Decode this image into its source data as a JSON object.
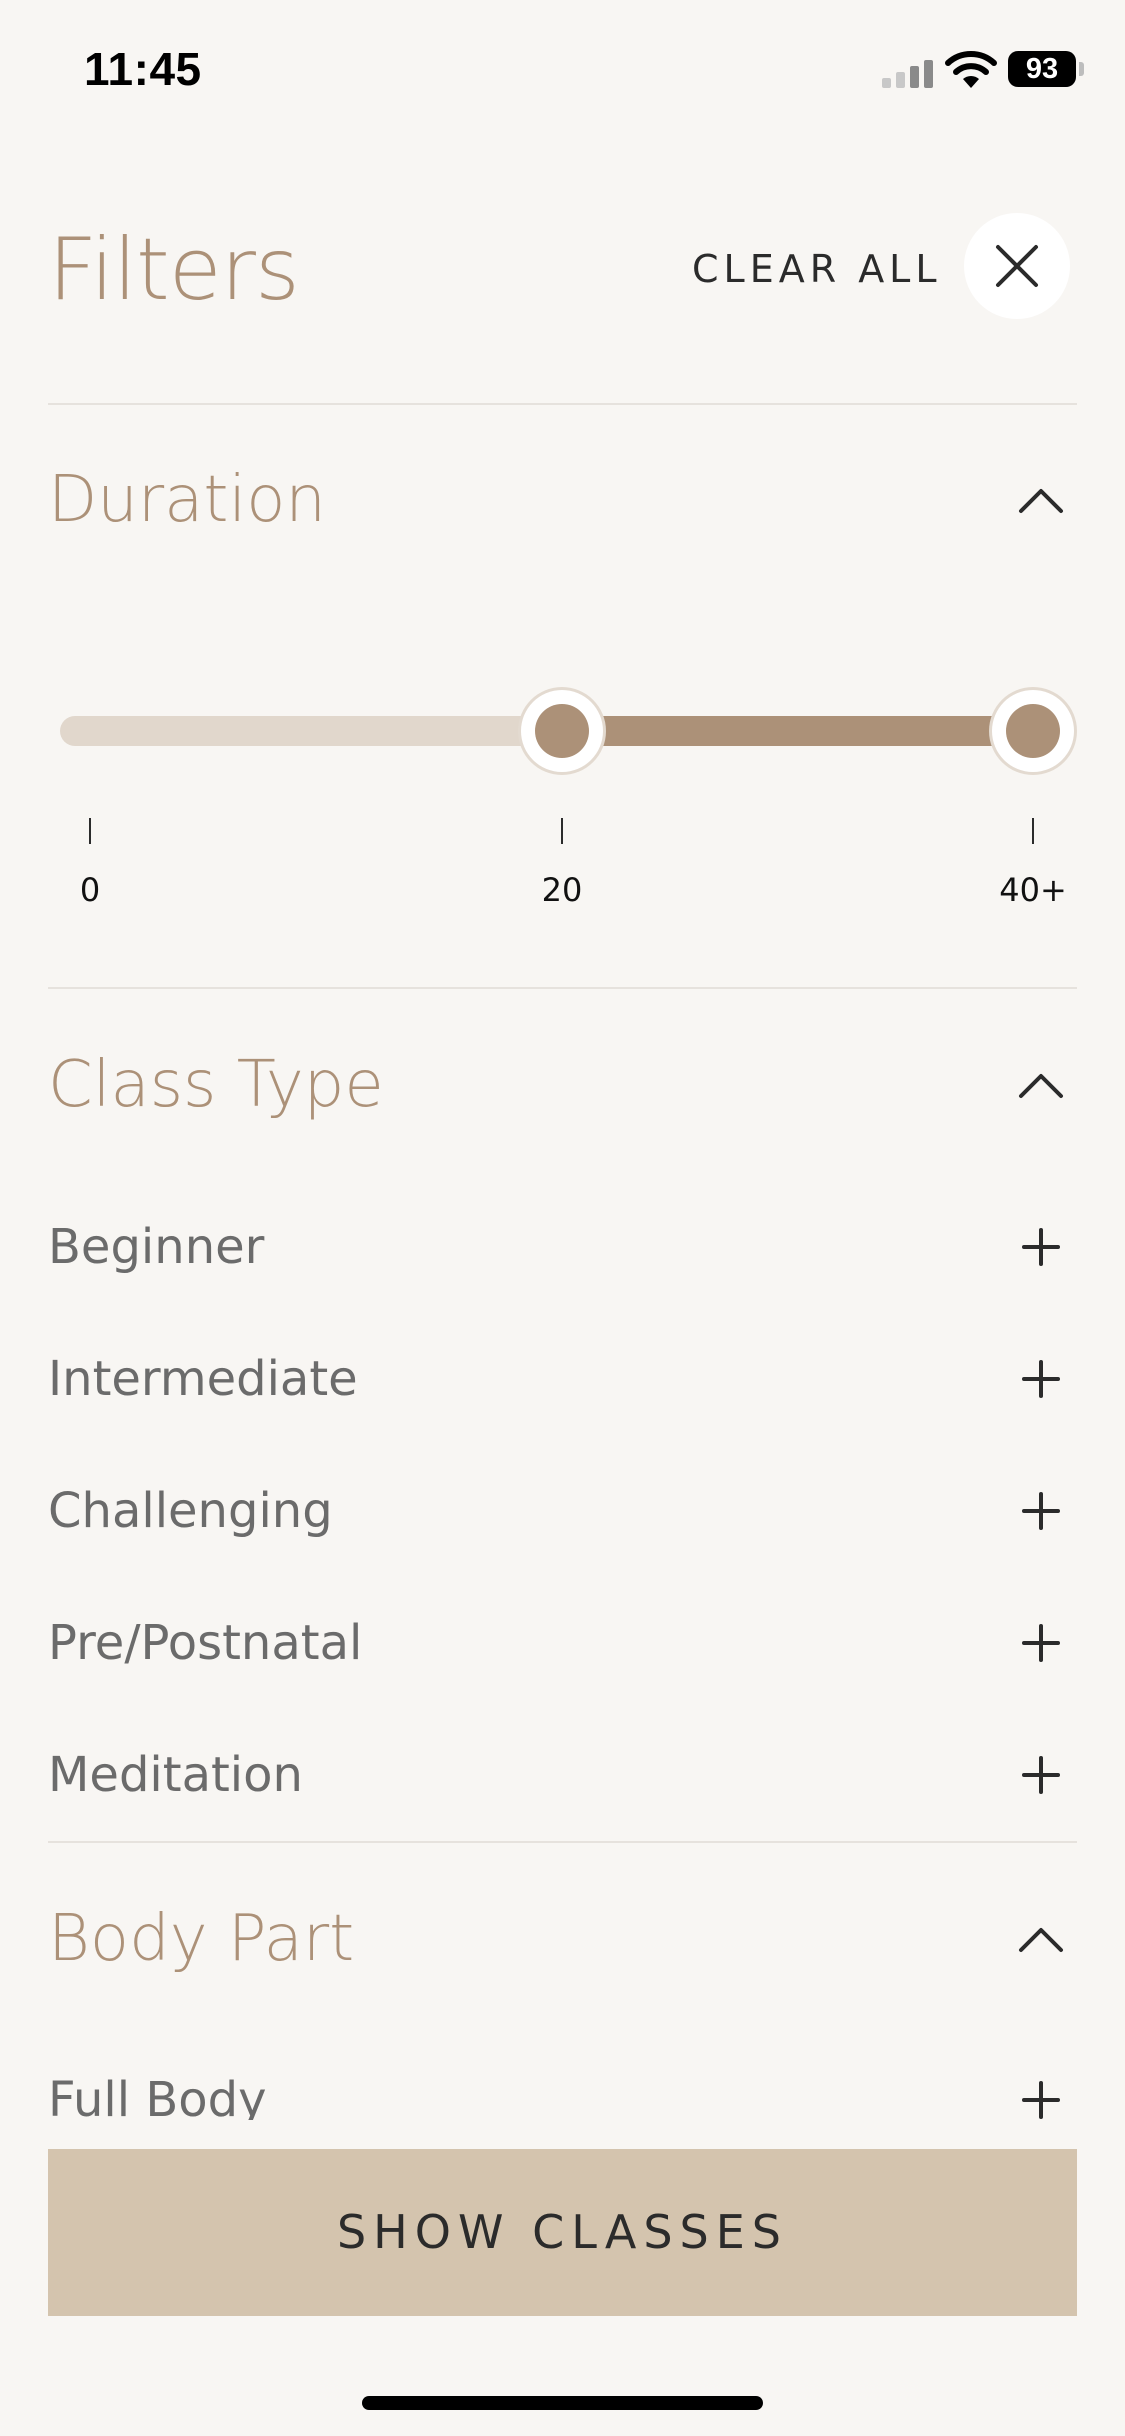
{
  "status_bar": {
    "time": "11:45",
    "battery": "93"
  },
  "header": {
    "title": "Filters",
    "clear_all_label": "CLEAR ALL",
    "close_icon": "close-icon"
  },
  "duration": {
    "title": "Duration",
    "expanded": true,
    "range": {
      "min_tick": "0",
      "mid_tick": "20",
      "max_tick": "40+",
      "scale_min": 0,
      "scale_max": 40,
      "selected_low": 20,
      "selected_high": 40
    }
  },
  "class_type": {
    "title": "Class Type",
    "expanded": true,
    "options": [
      "Beginner",
      "Intermediate",
      "Challenging",
      "Pre/Postnatal",
      "Meditation"
    ]
  },
  "body_part": {
    "title": "Body Part",
    "expanded": true,
    "options": [
      "Full Body"
    ]
  },
  "cta": {
    "label": "SHOW CLASSES"
  },
  "colors": {
    "accent": "#ac9178",
    "track": "#e1d7cc",
    "button_bg": "#d4c4ae",
    "background": "#f8f6f3"
  }
}
